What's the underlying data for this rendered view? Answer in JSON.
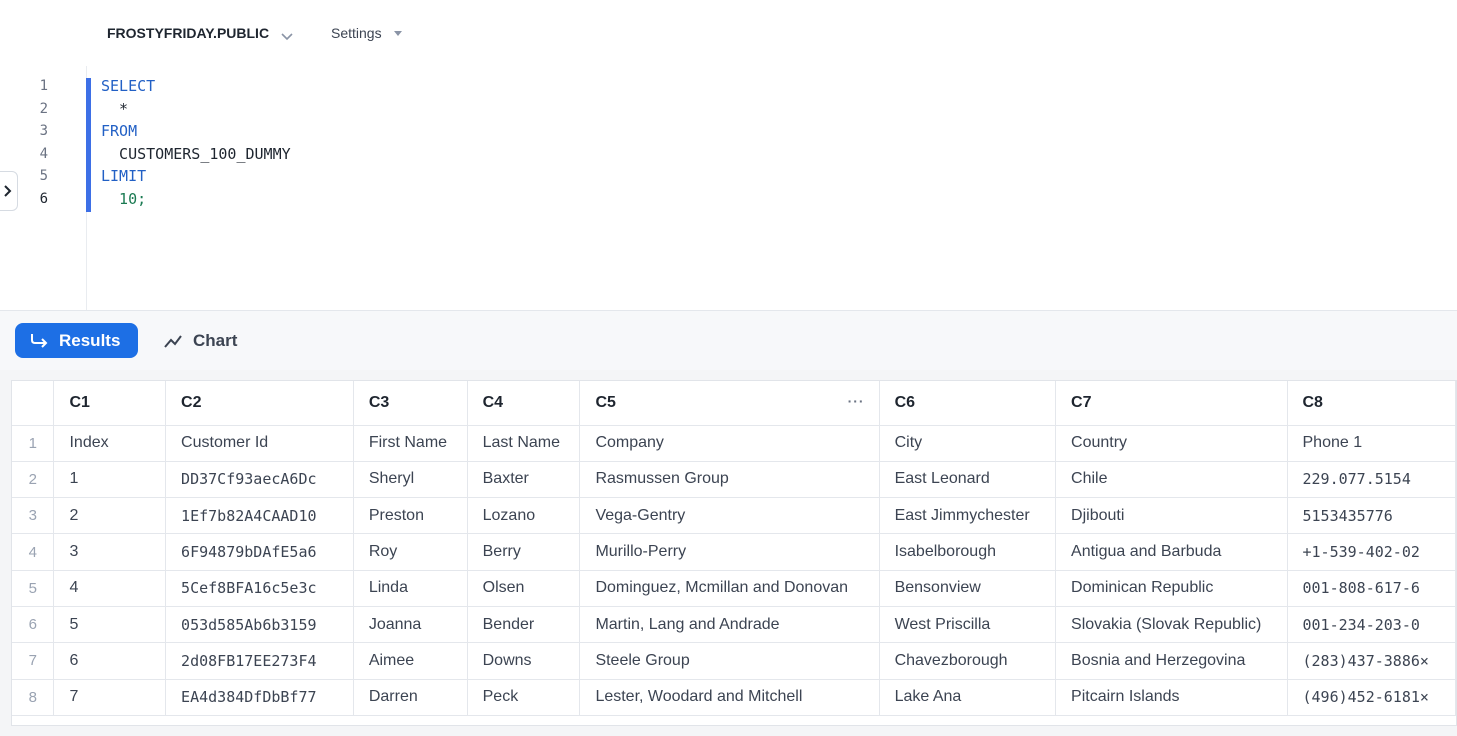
{
  "toolbar": {
    "context": "FROSTYFRIDAY.PUBLIC",
    "settings": "Settings"
  },
  "editor": {
    "lines": [
      {
        "num": "1",
        "text": "SELECT"
      },
      {
        "num": "2",
        "text": "  *"
      },
      {
        "num": "3",
        "text": "FROM"
      },
      {
        "num": "4",
        "text": "  CUSTOMERS_100_DUMMY"
      },
      {
        "num": "5",
        "text": "LIMIT"
      },
      {
        "num": "6",
        "text": "  10;"
      }
    ]
  },
  "tabs": {
    "results": "Results",
    "chart": "Chart"
  },
  "table": {
    "columns": [
      "C1",
      "C2",
      "C3",
      "C4",
      "C5",
      "C6",
      "C7",
      "C8"
    ],
    "rows": [
      [
        "1",
        "Index",
        "Customer Id",
        "First Name",
        "Last Name",
        "Company",
        "City",
        "Country",
        "Phone 1"
      ],
      [
        "2",
        "1",
        "DD37Cf93aecA6Dc",
        "Sheryl",
        "Baxter",
        "Rasmussen Group",
        "East Leonard",
        "Chile",
        "229.077.5154"
      ],
      [
        "3",
        "2",
        "1Ef7b82A4CAAD10",
        "Preston",
        "Lozano",
        "Vega-Gentry",
        "East Jimmychester",
        "Djibouti",
        "5153435776"
      ],
      [
        "4",
        "3",
        "6F94879bDAfE5a6",
        "Roy",
        "Berry",
        "Murillo-Perry",
        "Isabelborough",
        "Antigua and Barbuda",
        "+1-539-402-02"
      ],
      [
        "5",
        "4",
        "5Cef8BFA16c5e3c",
        "Linda",
        "Olsen",
        "Dominguez, Mcmillan and Donovan",
        "Bensonview",
        "Dominican Republic",
        "001-808-617-6"
      ],
      [
        "6",
        "5",
        "053d585Ab6b3159",
        "Joanna",
        "Bender",
        "Martin, Lang and Andrade",
        "West Priscilla",
        "Slovakia (Slovak Republic)",
        "001-234-203-0"
      ],
      [
        "7",
        "6",
        "2d08FB17EE273F4",
        "Aimee",
        "Downs",
        "Steele Group",
        "Chavezborough",
        "Bosnia and Herzegovina",
        "(283)437-3886×"
      ],
      [
        "8",
        "7",
        "EA4d384DfDbBf77",
        "Darren",
        "Peck",
        "Lester, Woodard and Mitchell",
        "Lake Ana",
        "Pitcairn Islands",
        "(496)452-6181×"
      ]
    ]
  },
  "icons": {
    "context_chevron": "chevron-down-icon",
    "settings_caret": "caret-down-icon",
    "sidebar_toggle": "chevron-right-icon",
    "results": "return-arrow-icon",
    "chart": "trend-line-icon",
    "column_menu": "more-horizontal-icon"
  },
  "colors": {
    "accent": "#1d6fe5",
    "keyword": "#2260c5",
    "number": "#1a7a52",
    "active_line_bar": "#3d6fe6"
  }
}
